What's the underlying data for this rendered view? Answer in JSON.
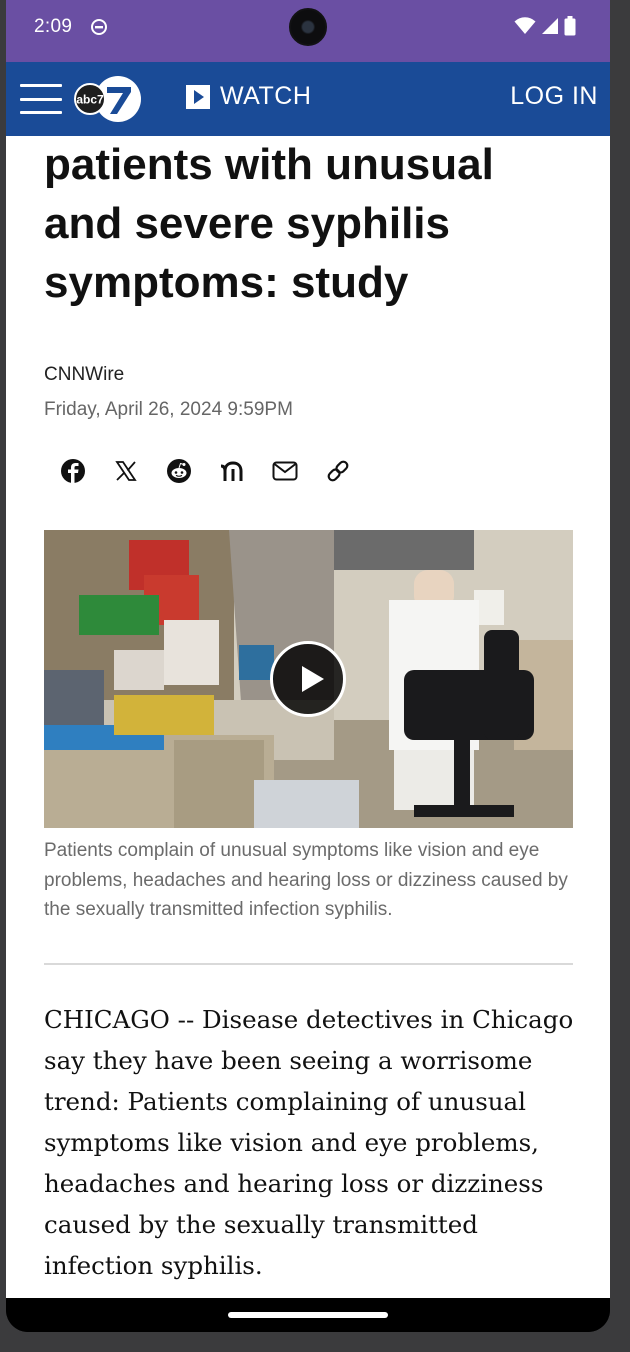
{
  "status_bar": {
    "time": "2:09",
    "icons": [
      "dnd-icon",
      "wifi-icon",
      "signal-icon",
      "battery-icon"
    ]
  },
  "header": {
    "menu_icon": "hamburger-menu-icon",
    "logo_text": "abc7",
    "watch_label": "WATCH",
    "login_label": "LOG IN",
    "colors": {
      "background": "#1a4b97",
      "status_bar": "#6a4fa3"
    }
  },
  "article": {
    "headline": "Doctors seeing more patients with unusual and severe syphilis symptoms: study",
    "byline": "CNNWire",
    "date": "Friday, April 26, 2024 9:59PM",
    "share_icons": [
      "facebook-icon",
      "x-icon",
      "reddit-icon",
      "nextdoor-icon",
      "email-icon",
      "link-icon"
    ],
    "media": {
      "play_icon": "play-icon"
    },
    "caption": "Patients complain of unusual symptoms like vision and eye problems, headaches and hearing loss or dizziness caused by the sexually transmitted infection syphilis.",
    "body": "CHICAGO -- Disease detectives in Chicago say they have been seeing a worrisome trend: Patients complaining of unusual symptoms like vision and eye problems, headaches and hearing loss or dizziness caused by the sexually transmitted infection syphilis."
  }
}
